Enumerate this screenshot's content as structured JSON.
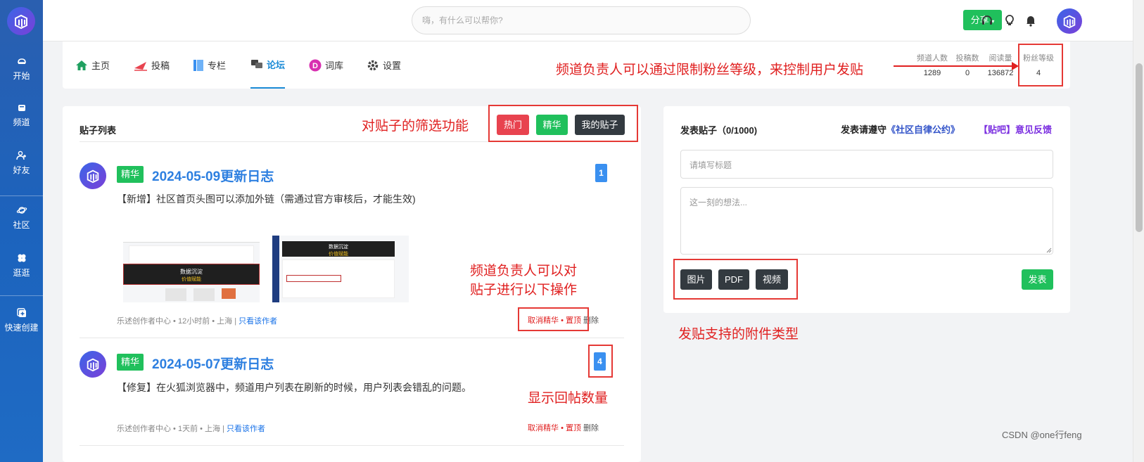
{
  "sidebar": {
    "items": [
      {
        "label": "开始",
        "icon": "home-icon"
      },
      {
        "label": "频道",
        "icon": "channel-icon"
      },
      {
        "label": "好友",
        "icon": "friends-icon"
      },
      {
        "label": "社区",
        "icon": "planet-icon"
      },
      {
        "label": "逛逛",
        "icon": "clover-icon"
      },
      {
        "label": "快速创建",
        "icon": "add-icon"
      }
    ]
  },
  "topbar": {
    "search_placeholder": "嗨，有什么可以帮你?",
    "share_label": "分享"
  },
  "nav": {
    "tabs": [
      {
        "label": "主页",
        "icon": "home-icon"
      },
      {
        "label": "投稿",
        "icon": "paper-plane-icon"
      },
      {
        "label": "专栏",
        "icon": "book-icon"
      },
      {
        "label": "论坛",
        "icon": "forum-icon",
        "active": true
      },
      {
        "label": "词库",
        "icon": "dict-icon"
      },
      {
        "label": "设置",
        "icon": "gear-icon"
      }
    ],
    "stats": [
      {
        "label": "频道人数",
        "value": "1289"
      },
      {
        "label": "投稿数",
        "value": "0"
      },
      {
        "label": "阅读量",
        "value": "136872"
      },
      {
        "label": "粉丝等级",
        "value": "4"
      }
    ]
  },
  "annotations": {
    "fan_level": "频道负责人可以通过限制粉丝等级，来控制用户发贴",
    "filter": "对贴子的筛选功能",
    "ops_line1": "频道负责人可以对",
    "ops_line2": "贴子进行以下操作",
    "reply_count": "显示回帖数量",
    "attach": "发贴支持的附件类型"
  },
  "post_list": {
    "title": "贴子列表",
    "filters": [
      {
        "label": "热门",
        "color": "#e8434f"
      },
      {
        "label": "精华",
        "color": "#20c05c"
      },
      {
        "label": "我的贴子",
        "color": "#333a40"
      }
    ],
    "posts": [
      {
        "badge": "精华",
        "title": "2024-05-09更新日志",
        "content": "【新增】社区首页头图可以添加外链（需通过官方审核后，才能生效)",
        "replies": "1",
        "images": [
          {
            "banner": "数据沉淀",
            "sub": "价值赋能"
          },
          {
            "banner": "数据沉淀",
            "sub": "价值赋能"
          }
        ],
        "meta_prefix": "乐述创作者中心 • 12小时前 • 上海 |",
        "meta_link": "只看该作者",
        "op_unfeature": "取消精华",
        "op_pin": "置顶",
        "op_sep": "•",
        "op_delete": "删除"
      },
      {
        "badge": "精华",
        "title": "2024-05-07更新日志",
        "content": "【修复】在火狐浏览器中，频道用户列表在刷新的时候，用户列表会错乱的问题。",
        "replies": "4",
        "meta_prefix": "乐述创作者中心 • 1天前 • 上海 |",
        "meta_link": "只看该作者",
        "op_unfeature": "取消精华",
        "op_pin": "置顶",
        "op_sep": "•",
        "op_delete": "删除"
      }
    ]
  },
  "compose": {
    "title": "发表贴子（0/1000)",
    "rules_prefix": "发表请遵守",
    "rules_link": "《社区自律公约》",
    "feedback": "【贴吧】意见反馈",
    "title_placeholder": "请填写标题",
    "content_placeholder": "这一刻的想法...",
    "attachments": [
      "图片",
      "PDF",
      "视频"
    ],
    "submit": "发表"
  },
  "watermark": "CSDN @one行feng"
}
